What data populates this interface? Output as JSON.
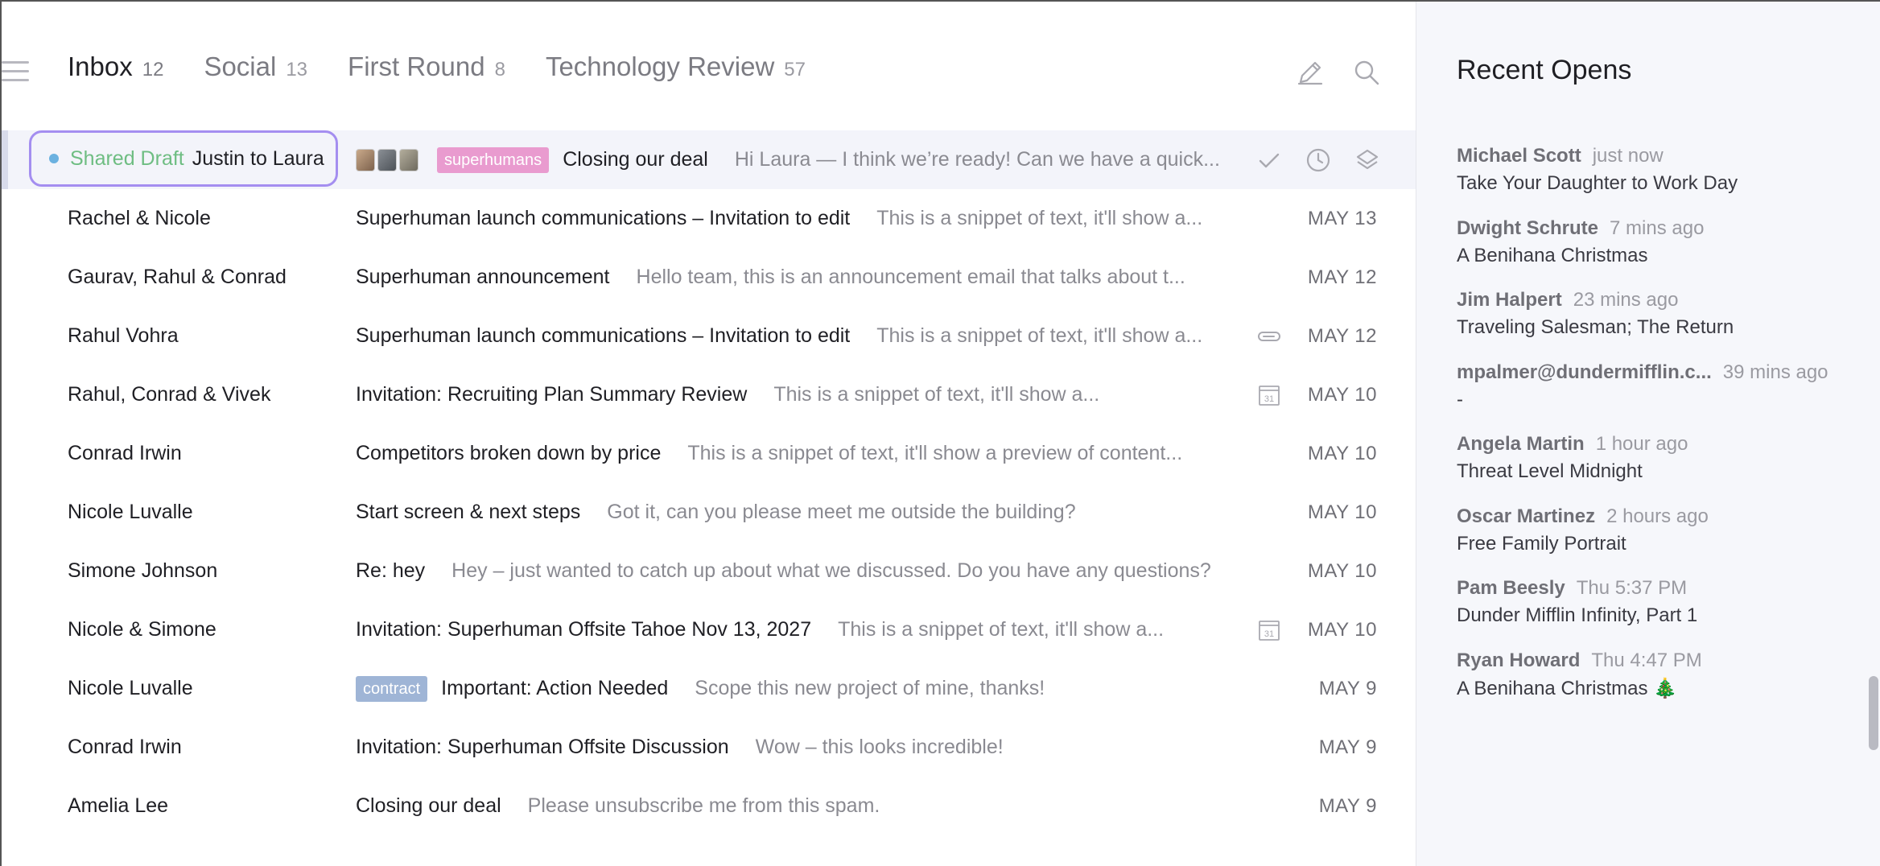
{
  "tabs": [
    {
      "label": "Inbox",
      "count": "12"
    },
    {
      "label": "Social",
      "count": "13"
    },
    {
      "label": "First Round",
      "count": "8"
    },
    {
      "label": "Technology Review",
      "count": "57"
    }
  ],
  "toolbar": {
    "compose_icon": "pencil-icon",
    "search_icon": "search-icon"
  },
  "draft_row": {
    "draft_label": "Shared Draft",
    "names": "Justin to Laura",
    "tag": "superhumans",
    "subject": "Closing our deal",
    "snippet": "Hi Laura — I think we’re ready! Can we have a quick...",
    "actions": [
      "check-icon",
      "clock-icon",
      "layers-icon"
    ]
  },
  "emails": [
    {
      "sender": "Rachel & Nicole",
      "subject": "Superhuman launch communications – Invitation to edit",
      "snippet": "This is a snippet of text, it'll show a...",
      "date": "MAY 13"
    },
    {
      "sender": "Gaurav, Rahul & Conrad",
      "subject": "Superhuman announcement",
      "snippet": "Hello team, this is an announcement email that talks about t...",
      "date": "MAY 12"
    },
    {
      "sender": "Rahul Vohra",
      "subject": "Superhuman launch communications – Invitation to edit",
      "snippet": "This is a snippet of text, it'll show a...",
      "date": "MAY 12",
      "icon": "paperclip-icon"
    },
    {
      "sender": "Rahul, Conrad & Vivek",
      "subject": "Invitation: Recruiting Plan Summary Review",
      "snippet": "This is a snippet of text, it'll show a...",
      "date": "MAY 10",
      "icon": "calendar-icon",
      "calendar_day": "31"
    },
    {
      "sender": "Conrad Irwin",
      "subject": "Competitors broken down by price",
      "snippet": "This is a snippet of text, it'll show a preview of content...",
      "date": "MAY 10"
    },
    {
      "sender": "Nicole Luvalle",
      "subject": "Start screen & next steps",
      "snippet": "Got it, can you please meet me outside the building?",
      "date": "MAY 10"
    },
    {
      "sender": "Simone Johnson",
      "subject": "Re: hey",
      "snippet": "Hey – just wanted to catch up about what we discussed. Do you have any questions?",
      "date": "MAY 10"
    },
    {
      "sender": "Nicole & Simone",
      "subject": "Invitation: Superhuman Offsite Tahoe Nov 13, 2027",
      "snippet": "This is a snippet of text, it'll show a...",
      "date": "MAY 10",
      "icon": "calendar-icon",
      "calendar_day": "31"
    },
    {
      "sender": "Nicole Luvalle",
      "tag": "contract",
      "subject": "Important: Action Needed",
      "snippet": "Scope this new project of mine, thanks!",
      "date": "MAY 9"
    },
    {
      "sender": "Conrad Irwin",
      "subject": "Invitation: Superhuman Offsite Discussion",
      "snippet": "Wow – this looks incredible!",
      "date": "MAY 9"
    },
    {
      "sender": "Amelia Lee",
      "subject": "Closing our deal",
      "snippet": "Please unsubscribe me from this spam.",
      "date": "MAY 9"
    }
  ],
  "sidebar": {
    "title": "Recent Opens",
    "items": [
      {
        "name": "Michael Scott",
        "time": "just now",
        "subject": "Take Your Daughter to Work Day"
      },
      {
        "name": "Dwight Schrute",
        "time": "7 mins ago",
        "subject": "A Benihana Christmas"
      },
      {
        "name": "Jim Halpert",
        "time": "23 mins ago",
        "subject": "Traveling Salesman; The Return"
      },
      {
        "name": "mpalmer@dundermifflin.c...",
        "time": "39 mins ago",
        "subject": "-"
      },
      {
        "name": "Angela Martin",
        "time": "1 hour ago",
        "subject": "Threat Level Midnight"
      },
      {
        "name": "Oscar Martinez",
        "time": "2 hours ago",
        "subject": "Free Family Portrait"
      },
      {
        "name": "Pam Beesly",
        "time": "Thu 5:37 PM",
        "subject": "Dunder Mifflin Infinity, Part 1"
      },
      {
        "name": "Ryan Howard",
        "time": "Thu 4:47 PM",
        "subject": "A Benihana Christmas 🎄"
      }
    ]
  }
}
